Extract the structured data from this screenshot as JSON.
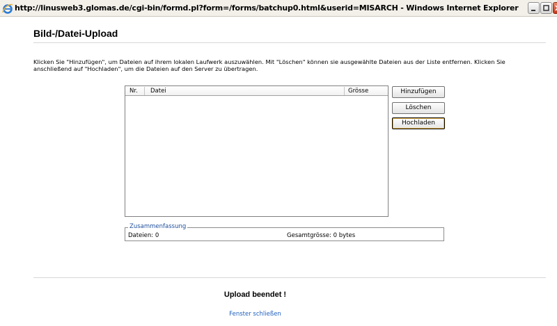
{
  "window": {
    "title": "http://linusweb3.glomas.de/cgi-bin/formd.pl?form=/forms/batchup0.html&userid=MISARCH - Windows Internet Explorer",
    "icons": {
      "app": "ie-icon",
      "minimize": "minimize-icon",
      "maximize": "maximize-icon",
      "close": "close-icon"
    }
  },
  "page": {
    "title": "Bild-/Datei-Upload",
    "instructions": "Klicken Sie \"Hinzufügen\", um Dateien auf ihrem lokalen Laufwerk auszuwählen. Mit \"Löschen\" können sie ausgewählte Dateien aus der Liste entfernen. Klicken Sie anschließend auf \"Hochladen\", um die Dateien auf den Server zu übertragen."
  },
  "file_list": {
    "columns": [
      "Nr.",
      "Datei",
      "Grösse"
    ],
    "rows": []
  },
  "buttons": {
    "add": "Hinzufügen",
    "delete": "Löschen",
    "upload": "Hochladen"
  },
  "summary": {
    "legend": "Zusammenfassung",
    "files": "Dateien: 0",
    "total": "Gesamtgrösse: 0 bytes"
  },
  "status": {
    "message": "Upload beendet !",
    "close_link": "Fenster schließen"
  },
  "colors": {
    "link": "#1f5fbf",
    "legend": "#1f4f9c"
  }
}
